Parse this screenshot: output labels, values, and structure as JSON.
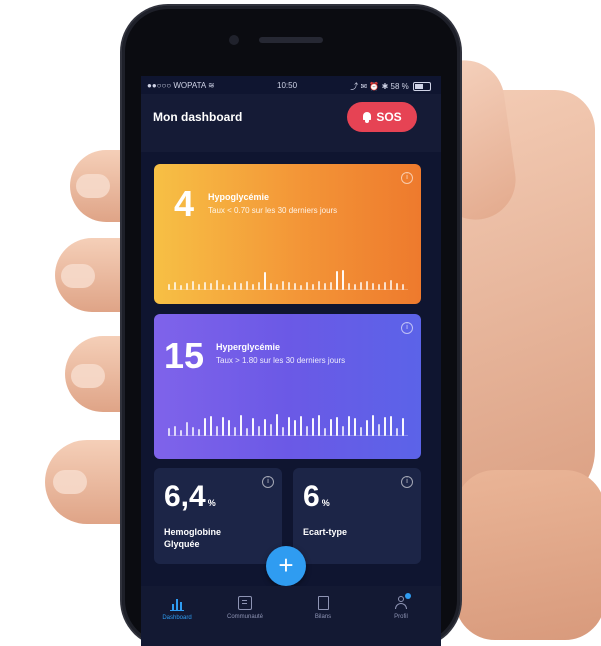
{
  "status_bar": {
    "carrier": "●●○○○ WOPATA ≋",
    "time": "10:50",
    "right": "⤴ ✉ ⏰ ✱ 58 %"
  },
  "header": {
    "title": "Mon dashboard",
    "sos_label": "SOS"
  },
  "cards": {
    "hypo": {
      "count": "4",
      "title": "Hypoglycémie",
      "subtitle": "Taux < 0.70 sur les 30 derniers jours",
      "gradient": [
        "#f7c045",
        "#ee7a2d"
      ]
    },
    "hyper": {
      "count": "15",
      "title": "Hyperglycémie",
      "subtitle": "Taux > 1.80 sur les 30 derniers jours",
      "gradient": [
        "#7f63ea",
        "#5b63e8"
      ]
    }
  },
  "metrics": {
    "hba1c": {
      "value": "6,4",
      "unit": "%",
      "label_line1": "Hemoglobine",
      "label_line2": "Glyquée"
    },
    "stddev": {
      "value": "6",
      "unit": "%",
      "label_line1": "Ecart-type",
      "label_line2": ""
    }
  },
  "fab": {
    "icon": "plus-icon",
    "symbol": "+"
  },
  "nav": {
    "items": [
      {
        "label": "Dashboard",
        "icon": "bar-chart-icon",
        "active": true
      },
      {
        "label": "Communauté",
        "icon": "community-icon",
        "active": false
      },
      {
        "label": "Bilans",
        "icon": "report-icon",
        "active": false
      },
      {
        "label": "Profil",
        "icon": "profile-icon",
        "active": false
      }
    ]
  },
  "colors": {
    "screen_bg": "#0f1530",
    "sos": "#e64354",
    "accent": "#2f9cf1",
    "card_dark": "#1c2547"
  }
}
